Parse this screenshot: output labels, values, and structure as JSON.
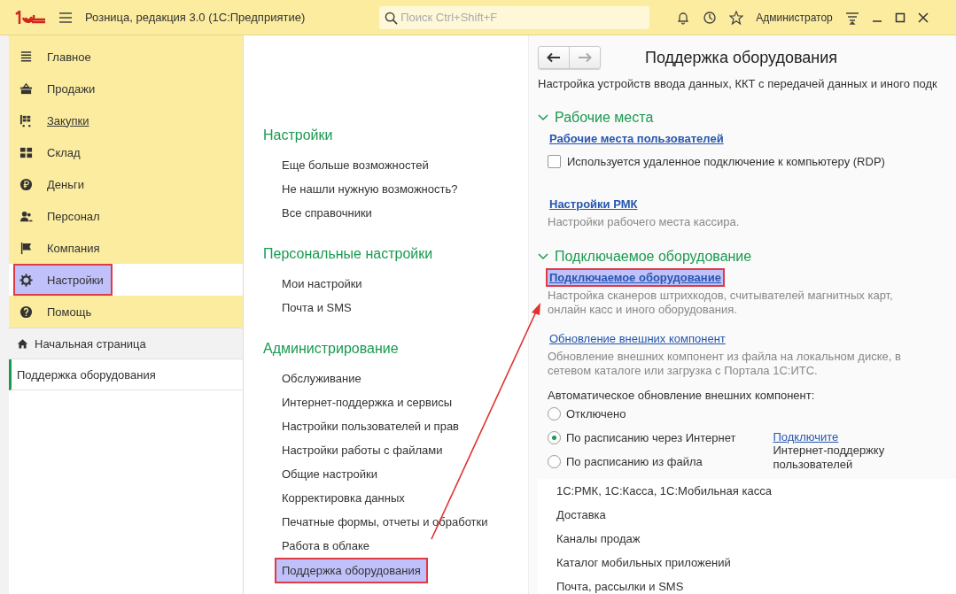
{
  "title_bar": {
    "app_title": "Розница, редакция 3.0  (1С:Предприятие)",
    "search": {
      "placeholder": "Поиск Ctrl+Shift+F"
    },
    "user": "Администратор"
  },
  "sidebar": {
    "items": [
      {
        "label": "Главное",
        "kind": "list",
        "selected": false,
        "underlined": false,
        "highlighted": false
      },
      {
        "label": "Продажи",
        "kind": "basket",
        "selected": false,
        "underlined": false,
        "highlighted": false
      },
      {
        "label": "Закупки",
        "kind": "cart",
        "selected": false,
        "underlined": true,
        "highlighted": false
      },
      {
        "label": "Склад",
        "kind": "grid",
        "selected": false,
        "underlined": false,
        "highlighted": false
      },
      {
        "label": "Деньги",
        "kind": "coin",
        "selected": false,
        "underlined": false,
        "highlighted": false
      },
      {
        "label": "Персонал",
        "kind": "people",
        "selected": false,
        "underlined": false,
        "highlighted": false
      },
      {
        "label": "Компания",
        "kind": "flag",
        "selected": false,
        "underlined": false,
        "highlighted": false
      },
      {
        "label": "Настройки",
        "kind": "gear",
        "selected": true,
        "underlined": false,
        "highlighted": true
      },
      {
        "label": "Помощь",
        "kind": "help",
        "selected": false,
        "underlined": false,
        "highlighted": false
      }
    ],
    "open_pages": [
      {
        "label": "Начальная страница",
        "kind": "home",
        "selected": false
      },
      {
        "label": "Поддержка оборудования",
        "kind": "page",
        "selected": true
      }
    ]
  },
  "menu": {
    "groups": [
      {
        "title": "Настройки",
        "items": [
          {
            "label": "Еще больше возможностей",
            "highlighted": false
          },
          {
            "label": "Не нашли нужную возможность?",
            "highlighted": false
          },
          {
            "label": "Все справочники",
            "highlighted": false
          }
        ]
      },
      {
        "title": "Персональные настройки",
        "items": [
          {
            "label": "Мои настройки",
            "highlighted": false
          },
          {
            "label": "Почта и SMS",
            "highlighted": false
          }
        ]
      },
      {
        "title": "Администрирование",
        "items": [
          {
            "label": "Обслуживание",
            "highlighted": false
          },
          {
            "label": "Интернет-поддержка и сервисы",
            "highlighted": false
          },
          {
            "label": "Настройки пользователей и прав",
            "highlighted": false
          },
          {
            "label": "Настройки работы с файлами",
            "highlighted": false
          },
          {
            "label": "Общие настройки",
            "highlighted": false
          },
          {
            "label": "Корректировка данных",
            "highlighted": false
          },
          {
            "label": "Печатные формы, отчеты и обработки",
            "highlighted": false
          },
          {
            "label": "Работа в облаке",
            "highlighted": false
          },
          {
            "label": "Поддержка оборудования",
            "highlighted": true
          }
        ]
      }
    ]
  },
  "panel": {
    "title": "Поддержка оборудования",
    "description": "Настройка устройств ввода данных, ККТ с передачей данных и иного подк",
    "sections": [
      {
        "title": "Рабочие места",
        "expanded": true,
        "items": [
          {
            "kind": "link",
            "label": "Рабочие места пользователей",
            "bold": true,
            "highlighted": false
          },
          {
            "kind": "checkbox",
            "label": "Используется удаленное подключение к компьютеру (RDP)",
            "checked": false
          },
          {
            "kind": "link",
            "label": "Настройки РМК",
            "bold": true,
            "highlighted": false,
            "description": "Настройки рабочего места кассира."
          }
        ]
      },
      {
        "title": "Подключаемое оборудование",
        "expanded": true,
        "items": [
          {
            "kind": "link",
            "label": "Подключаемое оборудование",
            "bold": true,
            "highlighted": true,
            "description": "Настройка сканеров штрихкодов, считывателей магнитных карт, онлайн касс и иного оборудования."
          },
          {
            "kind": "link",
            "label": "Обновление внешних компонент",
            "bold": false,
            "highlighted": false,
            "description": "Обновление внешних компонент из файла на локальном диске, в сетевом каталоге или загрузка с Портала 1С:ИТС."
          },
          {
            "kind": "radio_group",
            "label": "Автоматическое обновление внешних компонент:",
            "options": [
              {
                "label": "Отключено",
                "selected": false
              },
              {
                "label": "По расписанию через Интернет",
                "selected": true
              },
              {
                "label": "По расписанию из файла",
                "selected": false
              }
            ],
            "note_link": "Подключите",
            "note_text": "Интернет-поддержку пользователей"
          }
        ]
      }
    ],
    "other_items": [
      "1С:РМК, 1С:Касса, 1С:Мобильная касса",
      "Доставка",
      "Каналы продаж",
      "Каталог мобильных приложений",
      "Почта, рассылки и SMS"
    ]
  }
}
